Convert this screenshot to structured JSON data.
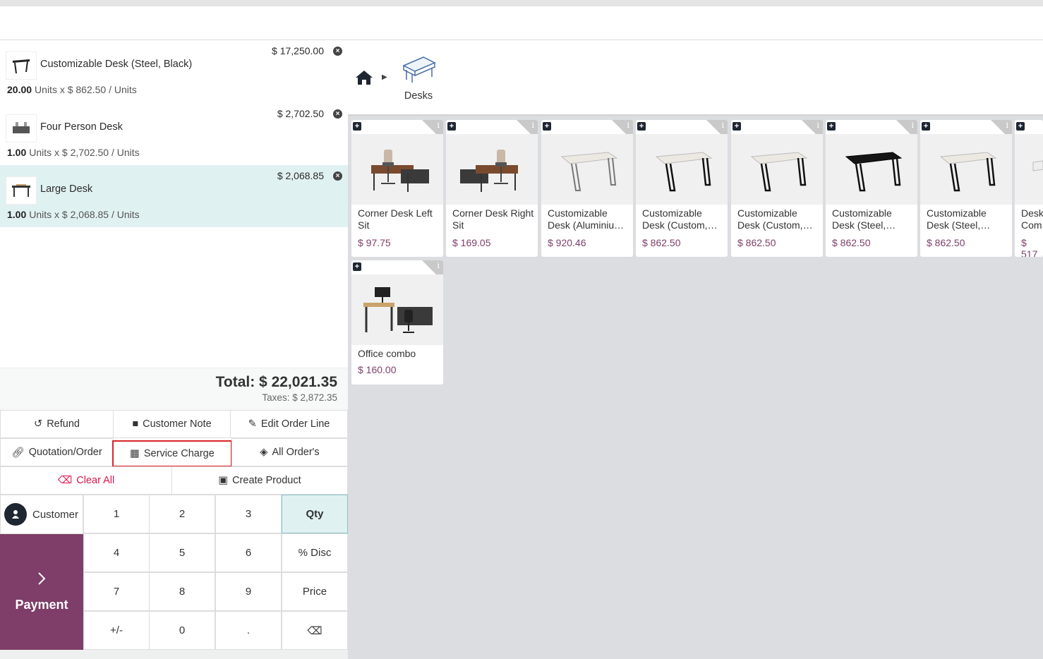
{
  "order_lines": [
    {
      "name": "Customizable Desk (Steel, Black)",
      "price": "$ 17,250.00",
      "qty": "20.00",
      "unit_text": "Units x $ 862.50 / Units",
      "selected": false
    },
    {
      "name": "Four Person Desk",
      "price": "$ 2,702.50",
      "qty": "1.00",
      "unit_text": "Units x $ 2,702.50 / Units",
      "selected": false
    },
    {
      "name": "Large Desk",
      "price": "$ 2,068.85",
      "qty": "1.00",
      "unit_text": "Units x $ 2,068.85 / Units",
      "selected": true
    }
  ],
  "totals": {
    "total": "Total: $ 22,021.35",
    "taxes": "Taxes: $ 2,872.35"
  },
  "controls": {
    "refund": "Refund",
    "customer_note": "Customer Note",
    "edit_order_line": "Edit Order Line",
    "quotation_order": "Quotation/Order",
    "service_charge": "Service Charge",
    "all_orders": "All Order's",
    "clear_all": "Clear All",
    "create_product": "Create Product"
  },
  "numpad": {
    "customer": "Customer",
    "payment": "Payment",
    "keys": [
      "1",
      "2",
      "3",
      "Qty",
      "4",
      "5",
      "6",
      "% Disc",
      "7",
      "8",
      "9",
      "Price",
      "+/-",
      "0",
      ".",
      "⌫"
    ],
    "active_mode": "Qty"
  },
  "breadcrumb": {
    "category": "Desks"
  },
  "products": [
    {
      "name": "Corner Desk Left Sit",
      "price": "$ 97.75",
      "icon": "corner-desk-image"
    },
    {
      "name": "Corner Desk Right Sit",
      "price": "$ 169.05",
      "icon": "corner-desk-image"
    },
    {
      "name": "Customizable Desk (Aluminiu…",
      "price": "$ 920.46",
      "icon": "white-desk-image"
    },
    {
      "name": "Customizable Desk (Custom,…",
      "price": "$ 862.50",
      "icon": "white-desk-image"
    },
    {
      "name": "Customizable Desk (Custom,…",
      "price": "$ 862.50",
      "icon": "white-desk-image"
    },
    {
      "name": "Customizable Desk (Steel,…",
      "price": "$ 862.50",
      "icon": "black-desk-image"
    },
    {
      "name": "Customizable Desk (Steel,…",
      "price": "$ 862.50",
      "icon": "white-desk-image"
    },
    {
      "name": "Desk Com",
      "price": "$ 517",
      "icon": "desk-image"
    },
    {
      "name": "Office combo",
      "price": "$ 160.00",
      "icon": "office-combo-image"
    }
  ],
  "colors": {
    "accent": "#7e3e69",
    "selected_row": "#e0f1f1",
    "danger": "#d8174b",
    "highlight_border": "#d9242a"
  }
}
